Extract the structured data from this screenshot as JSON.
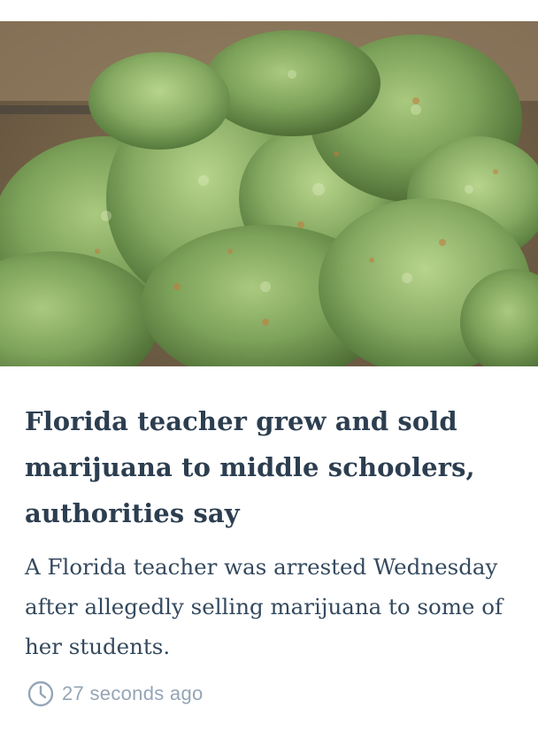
{
  "article": {
    "image_alt": "Close-up of green marijuana buds",
    "headline": "Florida teacher grew and sold marijuana to middle schoolers, authorities say",
    "summary": "A Florida teacher was arrested Wednesday after allegedly selling marijuana to some of her students.",
    "timestamp": "27 seconds ago",
    "timestamp_icon": "clock-icon"
  },
  "colors": {
    "headline": "#2c3e50",
    "summary": "#34495e",
    "timestamp": "#95a5b6",
    "background": "#ffffff"
  }
}
